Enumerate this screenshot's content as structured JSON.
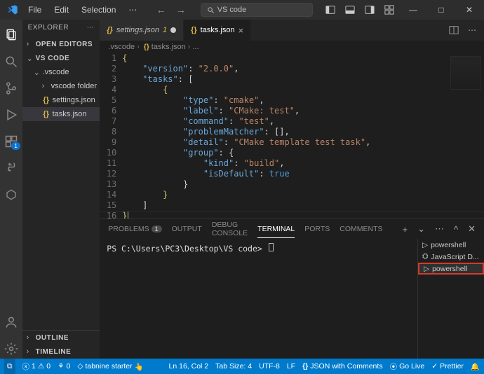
{
  "titlebar": {
    "menu": [
      "File",
      "Edit",
      "Selection",
      "⋯"
    ],
    "search_placeholder": "VS code",
    "win_min": "—",
    "win_max": "□",
    "win_close": "✕"
  },
  "activitybar": {
    "ext_badge": "1"
  },
  "sidebar": {
    "title": "EXPLORER",
    "open_editors": "OPEN EDITORS",
    "root": "VS CODE",
    "folder_vscode": ".vscode",
    "item_vfolder": "vscode folder",
    "item_settings": "settings.json",
    "item_tasks": "tasks.json",
    "outline": "OUTLINE",
    "timeline": "TIMELINE"
  },
  "tabs": {
    "settings": "settings.json",
    "settings_dirty": "1",
    "tasks": "tasks.json"
  },
  "breadcrumb": {
    "p1": ".vscode",
    "p2": "tasks.json",
    "p3": "..."
  },
  "code": {
    "lines": [
      "1",
      "2",
      "3",
      "4",
      "5",
      "6",
      "7",
      "8",
      "9",
      "10",
      "11",
      "12",
      "13",
      "14",
      "15",
      "16"
    ],
    "k_version": "\"version\"",
    "v_version": "\"2.0.0\"",
    "k_tasks": "\"tasks\"",
    "k_type": "\"type\"",
    "v_type": "\"cmake\"",
    "k_label": "\"label\"",
    "v_label": "\"CMake: test\"",
    "k_command": "\"command\"",
    "v_command": "\"test\"",
    "k_pm": "\"problemMatcher\"",
    "k_detail": "\"detail\"",
    "v_detail": "\"CMake template test task\"",
    "k_group": "\"group\"",
    "k_kind": "\"kind\"",
    "v_kind": "\"build\"",
    "k_isdef": "\"isDefault\"",
    "v_isdef": "true"
  },
  "panel": {
    "tabs": {
      "problems": "PROBLEMS",
      "problems_count": "1",
      "output": "OUTPUT",
      "debug": "DEBUG CONSOLE",
      "terminal": "TERMINAL",
      "ports": "PORTS",
      "comments": "COMMENTS"
    },
    "prompt": "PS C:\\Users\\PC3\\Desktop\\VS code>",
    "side": {
      "ps1": "powershell",
      "jsd": "JavaScript D...",
      "ps2": "powershell"
    }
  },
  "status": {
    "errors": "1",
    "warnings": "0",
    "ports": "0",
    "tabnine": "tabnine starter",
    "lncol": "Ln 16, Col 2",
    "tabsize": "Tab Size: 4",
    "enc": "UTF-8",
    "eol": "LF",
    "lang": "JSON with Comments",
    "golive": "Go Live",
    "prettier": "Prettier"
  }
}
